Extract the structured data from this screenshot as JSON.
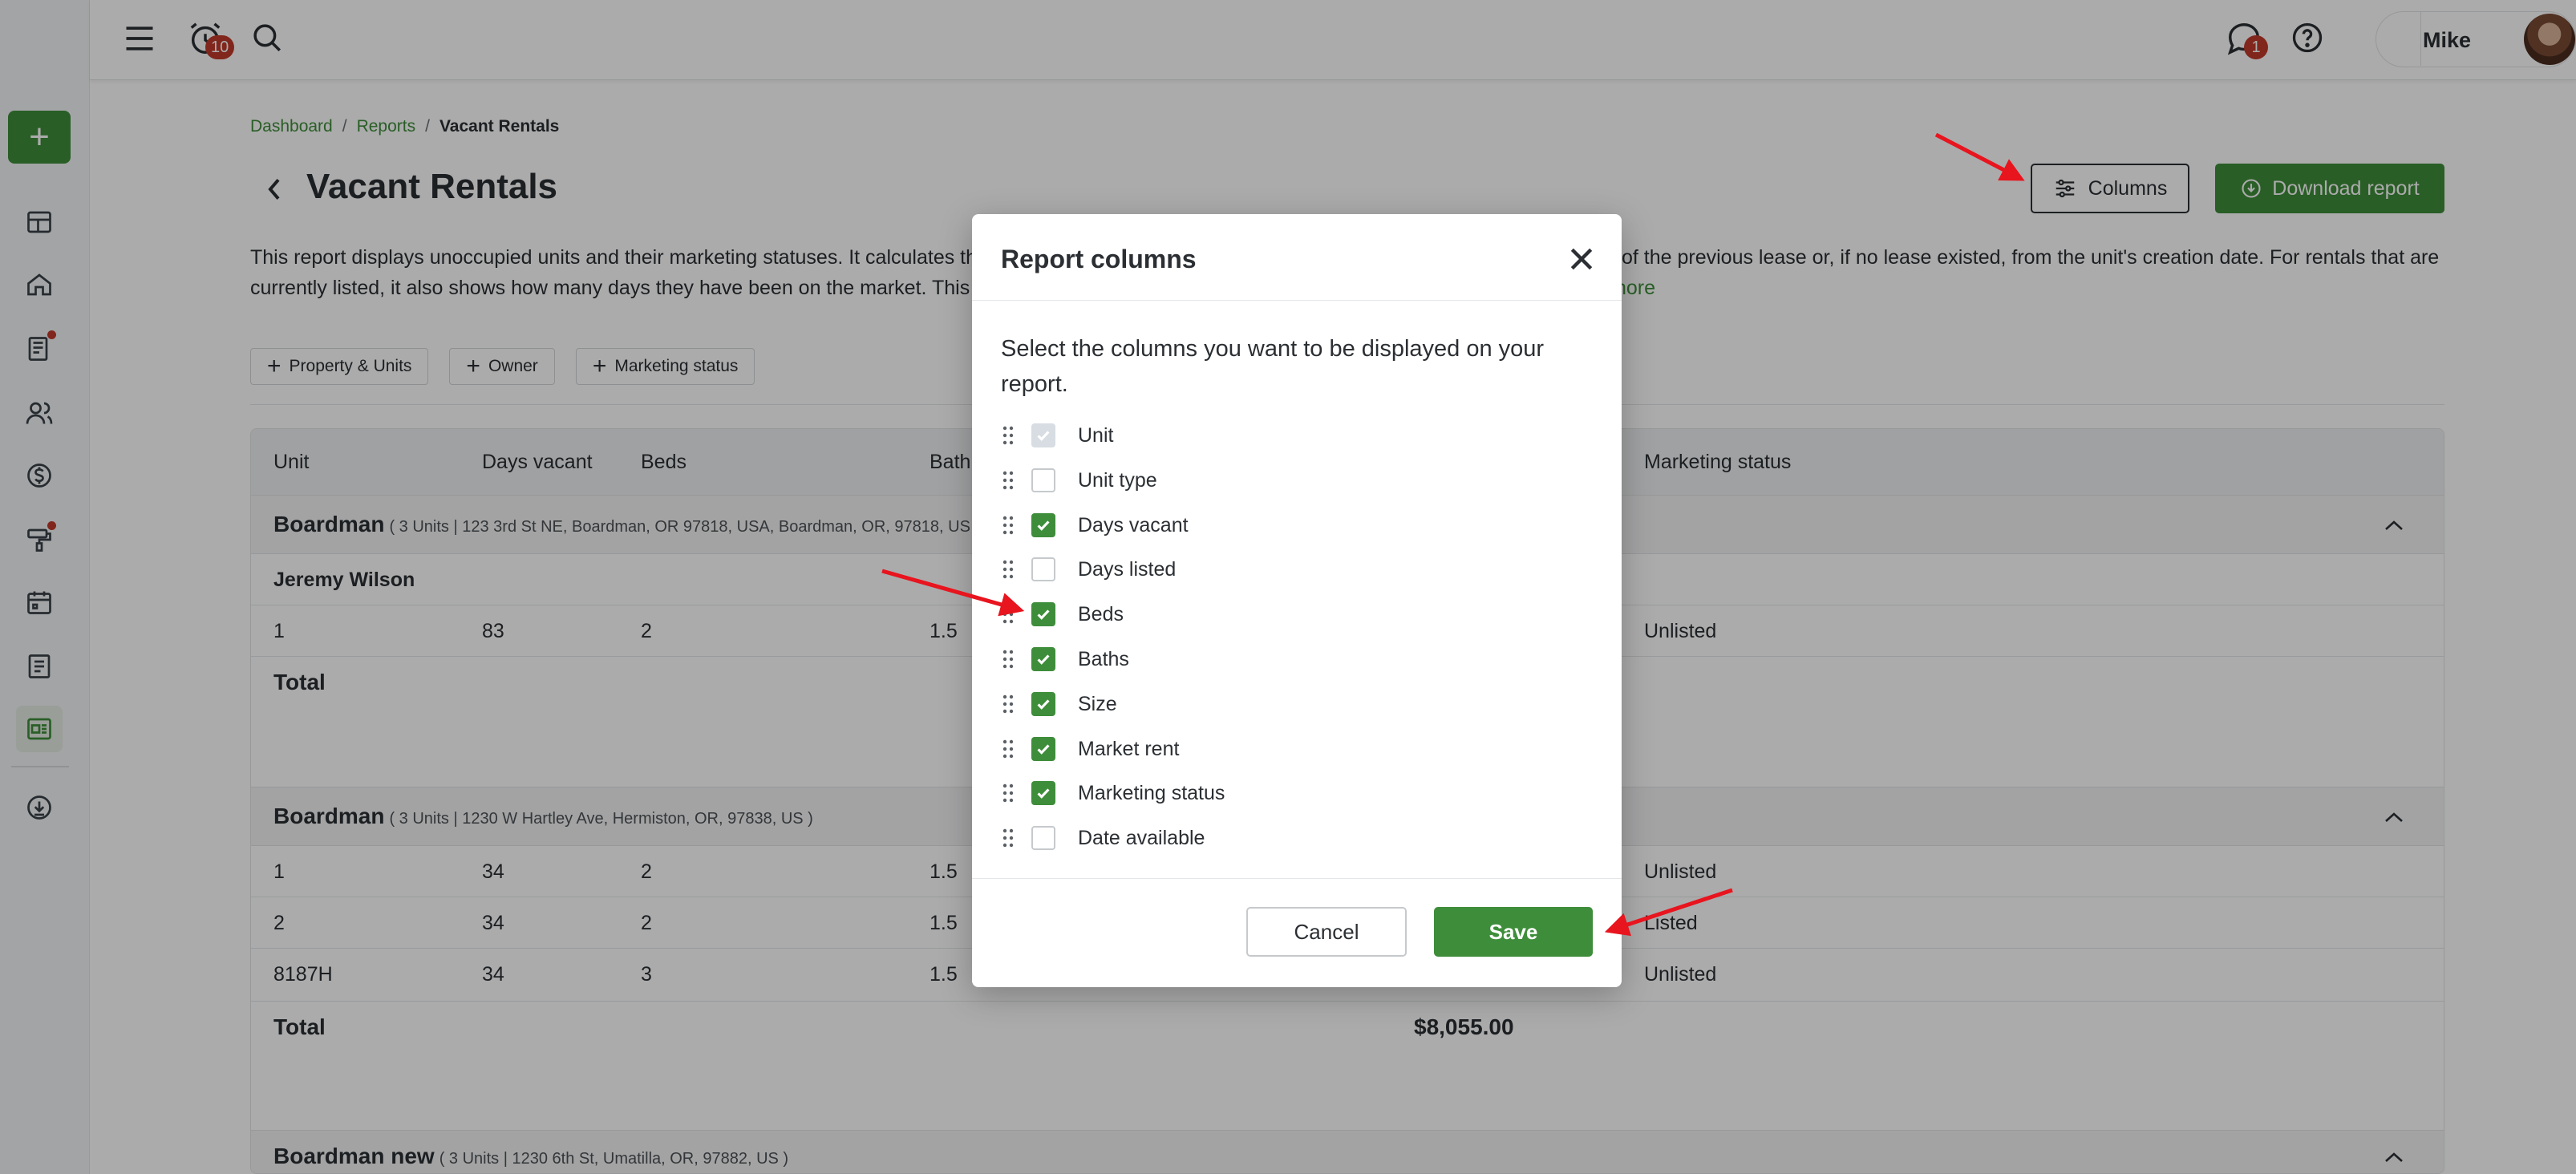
{
  "topbar": {
    "notifications_count": "10",
    "messages_count": "1",
    "user_name": "Mike"
  },
  "breadcrumb": [
    {
      "label": "Dashboard"
    },
    {
      "label": "Reports"
    },
    {
      "label": "Vacant Rentals"
    }
  ],
  "breadcrumb_separator": "/",
  "page": {
    "title": "Vacant Rentals",
    "columns_button": "Columns",
    "download_button": "Download report",
    "description_line1": "This report displays unoccupied units and their marketing statuses. It calculates th",
    "description_line1_right": "of the previous lease or, if no lease existed, from the unit's creation date. For rentals that are",
    "description_line2": "currently listed, it also shows how many days they have been on the market. This",
    "description_more": "nore"
  },
  "filters": [
    {
      "label": "Property & Units"
    },
    {
      "label": "Owner"
    },
    {
      "label": "Marketing status"
    }
  ],
  "table": {
    "headers": {
      "unit": "Unit",
      "days_vacant": "Days vacant",
      "beds": "Beds",
      "baths": "Bath",
      "marketing_status": "Marketing status"
    },
    "group1": {
      "title": "Boardman",
      "address": "( 3 Units | 123 3rd St NE, Boardman, OR 97818, USA, Boardman, OR, 97818, US",
      "owner": "Jeremy Wilson",
      "row": {
        "unit": "1",
        "days_vacant": "83",
        "beds": "2",
        "baths": "1.5",
        "status": "Unlisted"
      },
      "total_label": "Total"
    },
    "group2": {
      "title": "Boardman",
      "address": "( 3 Units | 1230 W Hartley Ave, Hermiston, OR, 97838, US )",
      "rows": [
        {
          "unit": "1",
          "days_vacant": "34",
          "beds": "2",
          "baths": "1.5",
          "status": "Unlisted"
        },
        {
          "unit": "2",
          "days_vacant": "34",
          "beds": "2",
          "baths": "1.5",
          "status": "Listed"
        },
        {
          "unit": "8187H",
          "days_vacant": "34",
          "beds": "3",
          "baths": "1.5",
          "status": "Unlisted"
        }
      ],
      "total_label": "Total",
      "total_amount": "$8,055.00"
    },
    "group3": {
      "title": "Boardman new",
      "address": "( 3 Units | 1230 6th St, Umatilla, OR, 97882, US )"
    }
  },
  "modal": {
    "title": "Report columns",
    "intro": "Select the columns you want to be displayed on your report.",
    "options": [
      {
        "label": "Unit",
        "checked": true,
        "disabled": true
      },
      {
        "label": "Unit type",
        "checked": false
      },
      {
        "label": "Days vacant",
        "checked": true
      },
      {
        "label": "Days listed",
        "checked": false
      },
      {
        "label": "Beds",
        "checked": true
      },
      {
        "label": "Baths",
        "checked": true
      },
      {
        "label": "Size",
        "checked": true
      },
      {
        "label": "Market rent",
        "checked": true
      },
      {
        "label": "Marketing status",
        "checked": true
      },
      {
        "label": "Date available",
        "checked": false
      }
    ],
    "cancel": "Cancel",
    "save": "Save"
  },
  "colors": {
    "accent": "#3e8d3a",
    "badge": "#c0392b",
    "annotation_arrow": "#e8141e"
  },
  "icons": [
    "menu-icon",
    "alarm-clock-icon",
    "search-icon",
    "chat-icon",
    "help-icon",
    "sliders-icon",
    "cloud-download-icon",
    "close-icon",
    "drag-handle-icon",
    "check-icon",
    "chevron-up-icon",
    "chevron-left-icon"
  ]
}
